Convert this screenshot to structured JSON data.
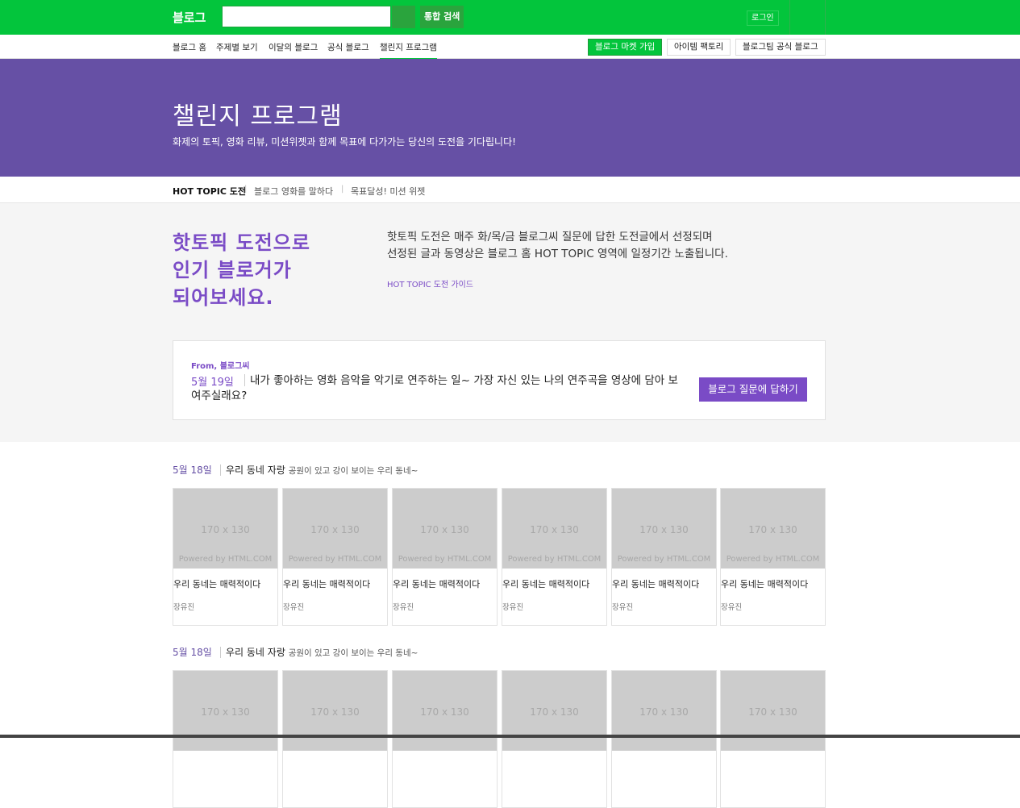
{
  "topbar": {
    "logo": "블로그",
    "search_placeholder": "",
    "search_button_label": "통합 검색",
    "login_label": "로그인"
  },
  "subnav": {
    "items": [
      "블로그 홈",
      "주제별 보기",
      "이달의 블로그",
      "공식 블로그",
      "챌린지 프로그램"
    ],
    "active_index": 4,
    "buttons": [
      "블로그 마켓 가입",
      "아이템 팩토리",
      "블로그팀 공식 블로그"
    ]
  },
  "hero": {
    "title": "챌린지 프로그램",
    "subtitle": "화제의 토픽, 영화 리뷰, 미션위젯과 함께 목표에 다가가는 당신의 도전을 기다립니다!"
  },
  "tabs": [
    "HOT TOPIC 도전",
    "블로그 영화를 말하다",
    "목표달성! 미션 위젯"
  ],
  "intro": {
    "headline": [
      "핫토픽 도전으로",
      "인기 블로거가",
      "되어보세요."
    ],
    "desc": [
      "핫토픽 도전은 매주 화/목/금 블로그씨 질문에 답한 도전글에서 선정되며",
      "선정된 글과 동영상은 블로그 홈 HOT TOPIC 영역에 일정기간 노출됩니다."
    ],
    "guide_link": "HOT TOPIC 도전 가이드"
  },
  "question_card": {
    "from": "From, 블로그씨",
    "date": "5월 19일",
    "question": "내가 좋아하는 영화 음악을 악기로 연주하는 일~ 가장 자신 있는 나의 연주곡을 영상에 담아 보여주실래요?",
    "button": "블로그 질문에 답하기"
  },
  "sections": [
    {
      "date": "5월 18일",
      "title": "우리 동네 자랑",
      "sub": "공원이 있고 강이 보이는 우리 동네~",
      "posts": [
        {
          "thumb": "170 x 130",
          "powered": "Powered by HTML.COM",
          "title": "우리 동네는 매력적이다",
          "author": "장유진"
        },
        {
          "thumb": "170 x 130",
          "powered": "Powered by HTML.COM",
          "title": "우리 동네는 매력적이다",
          "author": "장유진"
        },
        {
          "thumb": "170 x 130",
          "powered": "Powered by HTML.COM",
          "title": "우리 동네는 매력적이다",
          "author": "장유진"
        },
        {
          "thumb": "170 x 130",
          "powered": "Powered by HTML.COM",
          "title": "우리 동네는 매력적이다",
          "author": "장유진"
        },
        {
          "thumb": "170 x 130",
          "powered": "Powered by HTML.COM",
          "title": "우리 동네는 매력적이다",
          "author": "장유진"
        },
        {
          "thumb": "170 x 130",
          "powered": "Powered by HTML.COM",
          "title": "우리 동네는 매력적이다",
          "author": "장유진"
        }
      ]
    },
    {
      "date": "5월 18일",
      "title": "우리 동네 자랑",
      "sub": "공원이 있고 강이 보이는 우리 동네~",
      "posts": [
        {
          "thumb": "170 x 130",
          "powered": "",
          "title": "",
          "author": ""
        },
        {
          "thumb": "170 x 130",
          "powered": "",
          "title": "",
          "author": ""
        },
        {
          "thumb": "170 x 130",
          "powered": "",
          "title": "",
          "author": ""
        },
        {
          "thumb": "170 x 130",
          "powered": "",
          "title": "",
          "author": ""
        },
        {
          "thumb": "170 x 130",
          "powered": "",
          "title": "",
          "author": ""
        },
        {
          "thumb": "170 x 130",
          "powered": "",
          "title": "",
          "author": ""
        }
      ]
    }
  ],
  "colors": {
    "brand_green": "#03c53c",
    "hero_purple": "#6650a5",
    "accent_purple": "#7a4bc6"
  }
}
